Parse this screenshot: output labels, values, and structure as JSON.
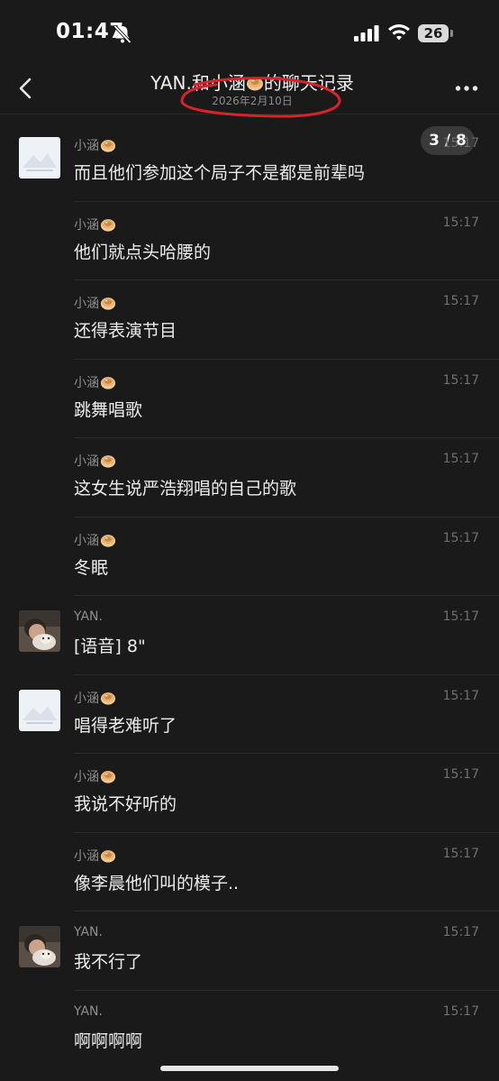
{
  "status_bar": {
    "time": "01:47",
    "battery": "26"
  },
  "header": {
    "title_prefix": "YAN.和小涵",
    "title_suffix": "的聊天记录",
    "subtitle": "2026年2月10日"
  },
  "page_counter": "3 / 8",
  "messages": [
    {
      "sender": "小涵",
      "time": "15:17",
      "text": "而且他们参加这个局子不是都是前辈吗",
      "avatar": "placeholder"
    },
    {
      "sender": "小涵",
      "time": "15:17",
      "text": "他们就点头哈腰的",
      "avatar": ""
    },
    {
      "sender": "小涵",
      "time": "15:17",
      "text": "还得表演节目",
      "avatar": ""
    },
    {
      "sender": "小涵",
      "time": "15:17",
      "text": "跳舞唱歌",
      "avatar": ""
    },
    {
      "sender": "小涵",
      "time": "15:17",
      "text": "这女生说严浩翔唱的自己的歌",
      "avatar": ""
    },
    {
      "sender": "小涵",
      "time": "15:17",
      "text": "冬眠",
      "avatar": ""
    },
    {
      "sender": "YAN.",
      "time": "15:17",
      "text": "[语音] 8\"",
      "avatar": "photo"
    },
    {
      "sender": "小涵",
      "time": "15:17",
      "text": "唱得老难听了",
      "avatar": "placeholder"
    },
    {
      "sender": "小涵",
      "time": "15:17",
      "text": "我说不好听的",
      "avatar": ""
    },
    {
      "sender": "小涵",
      "time": "15:17",
      "text": "像李晨他们叫的模子..",
      "avatar": ""
    },
    {
      "sender": "YAN.",
      "time": "15:17",
      "text": "我不行了",
      "avatar": "photo"
    },
    {
      "sender": "YAN.",
      "time": "15:17",
      "text": "啊啊啊啊",
      "avatar": ""
    }
  ],
  "colors": {
    "background": "#1a1a1a",
    "annotation": "#d8232a"
  },
  "icons": {
    "back": "chevron-left-icon",
    "more": "more-dots-icon",
    "emoji": "bun-emoji-icon"
  }
}
